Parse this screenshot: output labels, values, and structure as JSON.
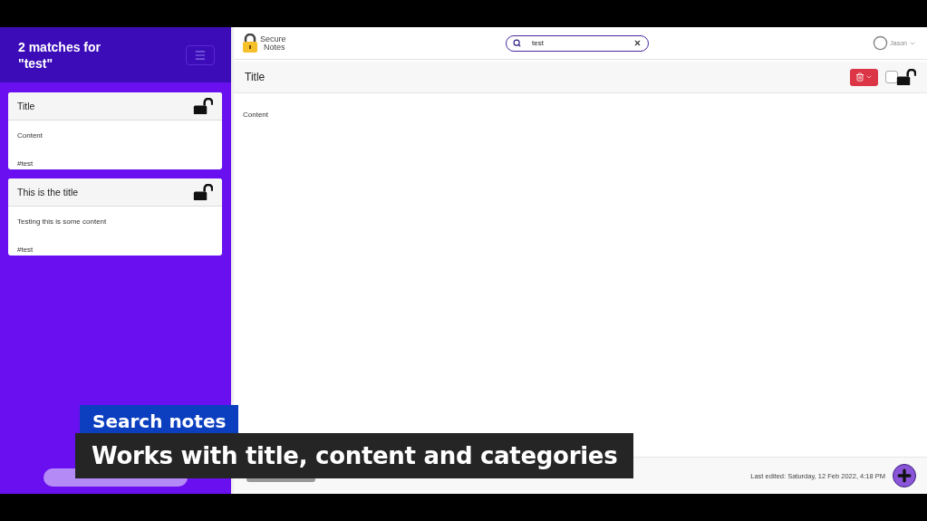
{
  "sidebar": {
    "heading": "2 matches for \"test\"",
    "notes": [
      {
        "title": "Title",
        "content": "Content",
        "tags": "#test",
        "locked": false
      },
      {
        "title": "This is the title",
        "content": "Testing this is some content",
        "tags": "#test",
        "locked": false
      }
    ]
  },
  "logo": {
    "line1": "Secure",
    "line2": "Notes"
  },
  "search": {
    "value": "test"
  },
  "user": {
    "name": "Jason"
  },
  "editor": {
    "title": "Title",
    "checked": false,
    "locked": false,
    "content": "Content",
    "last_edited": "Last edited: Saturday, 12 Feb 2022, 4:18 PM"
  },
  "caption": {
    "heading": "Search notes",
    "text": "Works with title, content and categories"
  }
}
